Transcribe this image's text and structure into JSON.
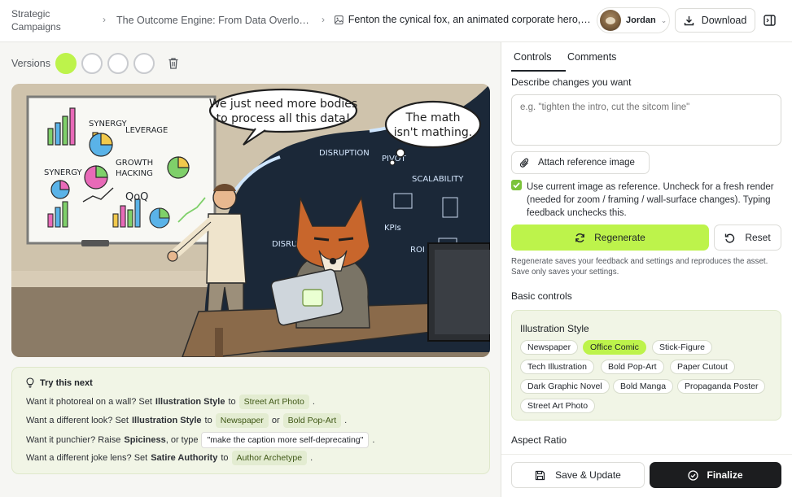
{
  "breadcrumb": {
    "root": "Strategic Campaigns",
    "campaign": "The Outcome Engine: From Data Overload to...",
    "asset": "Fenton the cynical fox, an animated corporate hero, ef..."
  },
  "user": {
    "name": "Jordan"
  },
  "toolbar": {
    "download_label": "Download"
  },
  "versions": {
    "label": "Versions",
    "count": 4,
    "active_index": 0
  },
  "artwork": {
    "bubble_human": "We just need more bodies to process all this data!",
    "bubble_human_line1": "We just need more bodies",
    "bubble_human_line2": "to process all this data!",
    "bubble_fox_line1": "The math",
    "bubble_fox_line2": "isn't mathing.",
    "board_words": [
      "SYNERGY",
      "LEVERAGE",
      "GROWTH",
      "HACKING",
      "SYNERGY",
      "QoQ"
    ],
    "wave_words": [
      "DISRUPTION",
      "PIVOT",
      "SCALABILITY",
      "KPIs",
      "ROI",
      "DISRUPTION"
    ]
  },
  "tips": {
    "title": "Try this next",
    "rows": [
      {
        "pre": "Want it photoreal on a wall? Set",
        "bold": "Illustration Style",
        "mid": "to",
        "chip1": "Street Art Photo",
        "end": "."
      },
      {
        "pre": "Want a different look? Set",
        "bold": "Illustration Style",
        "mid": "to",
        "chip1": "Newspaper",
        "or": "or",
        "chip2": "Bold Pop-Art",
        "end": "."
      },
      {
        "pre": "Want it punchier? Raise",
        "bold": "Spiciness",
        "mid": ", or type",
        "chip1": "\"make the caption more self-deprecating\"",
        "end": "."
      },
      {
        "pre": "Want a different joke lens? Set",
        "bold": "Satire Authority",
        "mid": "to",
        "chip1": "Author Archetype",
        "end": "."
      }
    ]
  },
  "panel": {
    "tabs": [
      "Controls",
      "Comments"
    ],
    "describe_label": "Describe changes you want",
    "describe_placeholder": "e.g. \"tighten the intro, cut the sitcom line\"",
    "attach_label": "Attach reference image",
    "use_current_text": "Use current image as reference. Uncheck for a fresh render (needed for zoom / framing / wall-surface changes). Typing feedback unchecks this.",
    "use_current_checked": true,
    "regenerate_label": "Regenerate",
    "reset_label": "Reset",
    "help_text": "Regenerate saves your feedback and settings and reproduces the asset. Save only saves your settings.",
    "basic_controls_label": "Basic controls",
    "style_title": "Illustration Style",
    "style_options": [
      "Newspaper",
      "Office Comic",
      "Stick-Figure",
      "Tech Illustration",
      "Bold Pop-Art",
      "Paper Cutout",
      "Dark Graphic Novel",
      "Bold Manga",
      "Propaganda Poster",
      "Street Art Photo"
    ],
    "style_selected": "Office Comic",
    "aspect_ratio_label": "Aspect Ratio",
    "save_label": "Save & Update",
    "finalize_label": "Finalize"
  },
  "colors": {
    "accent": "#bdf34b",
    "dark": "#1c1d1f",
    "tip_bg": "#f1f5e6"
  }
}
